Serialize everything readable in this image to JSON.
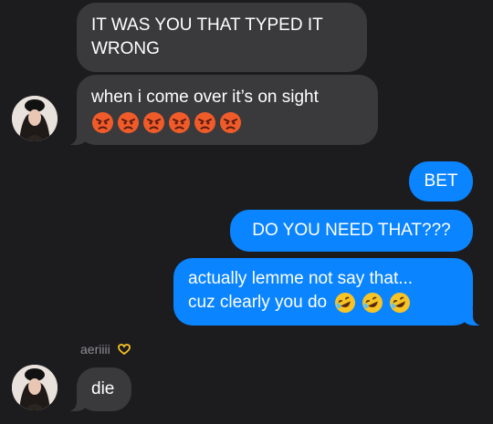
{
  "messages": {
    "m1": {
      "line1": "IT WAS YOU THAT TYPED IT",
      "line2": "WRONG"
    },
    "m2": {
      "text": "when i come over it’s on sight",
      "emojis": [
        "angry-face",
        "angry-face",
        "angry-face",
        "angry-face",
        "angry-face",
        "angry-face"
      ]
    },
    "m3": {
      "text": "BET"
    },
    "m4": {
      "text": "DO YOU NEED THAT???"
    },
    "m5": {
      "line1": "actually lemme not say that...",
      "line2": "cuz clearly you do",
      "emojis": [
        "rofl-face",
        "rofl-face",
        "rofl-face"
      ]
    },
    "sender": {
      "name": "aeriiii",
      "icon": "heart-hands-emoji"
    },
    "m6": {
      "text": "die"
    }
  },
  "colors": {
    "background": "#1c1c1e",
    "incoming_bubble": "#3a3a3c",
    "outgoing_bubble": "#0a84ff",
    "text": "#ffffff",
    "sender_name": "#8e8e93"
  }
}
